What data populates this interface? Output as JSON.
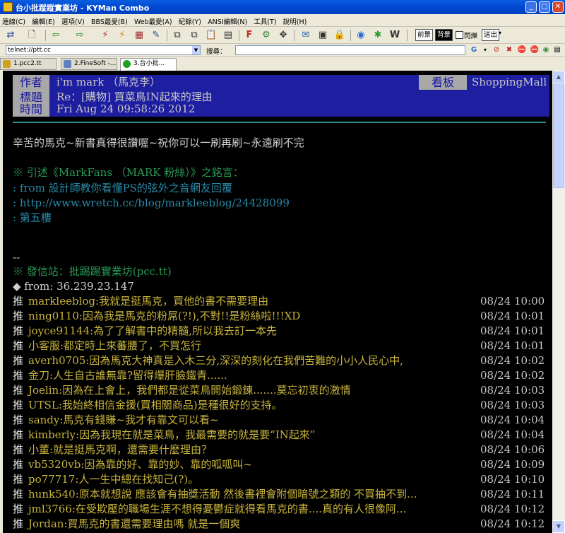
{
  "window": {
    "title": "台小批蹤蹤實業坊 - KYMan Combo"
  },
  "menu": [
    "連線(C)",
    "編輯(E)",
    "選項(V)",
    "BBS最愛(B)",
    "Web最愛(A)",
    "紀錄(Y)",
    "ANSI編輯(N)",
    "工具(T)",
    "說明(H)"
  ],
  "toolbar": {
    "labels": [
      "前景",
      "背景",
      "閃爍",
      "送出"
    ]
  },
  "address": {
    "value": "telnet://ptt.cc",
    "search_label": "搜尋：",
    "search_value": ""
  },
  "tabs": [
    {
      "label": "1.pcc2.tt",
      "icon": "#d0a020"
    },
    {
      "label": "2.FineSoft -...",
      "icon": "#6080c0"
    },
    {
      "label": "3.台小批...",
      "icon": "#20a020"
    }
  ],
  "post": {
    "author_label": "作者",
    "author": "i'm mark （馬克李）",
    "board_label": "看板",
    "board": "ShoppingMall",
    "title_label": "標題",
    "title": "Re：[購物] 買菜鳥IN起來的理由",
    "time_label": "時間",
    "time": "Fri Aug 24  09:58:26 2012",
    "body": "辛苦的馬克~新書真得很讚喔~祝你可以一刷再刷~永遠刷不完",
    "quote_header": "※ 引述《MarkFans （MARK 粉絲）》之銘言：",
    "quote_lines": [
      ": from 設計師教你看懂PS的弦外之音網友回覆",
      ": http://www.wretch.cc/blog/markleeblog/24428099",
      ": 第五樓"
    ],
    "sig_dash": "--",
    "sig_site": "※ 發信站：批踢踢實業坊(pcc.tt)",
    "sig_from": "◆ from: 36.239.23.147"
  },
  "pushes": [
    {
      "tag": "推",
      "text": "markleeblog:我就是挺馬克，買他的書不需要理由",
      "time": "08/24 10:00"
    },
    {
      "tag": "推",
      "text": "ning0110:因為我是馬克的粉屌(?!),不對!!是粉絲啦!!!XD",
      "time": "08/24 10:01"
    },
    {
      "tag": "推",
      "text": "joyce91144:為了了解書中的精髓,所以我去訂一本先",
      "time": "08/24 10:01"
    },
    {
      "tag": "推",
      "text": "小客服:都定時上來蕃腰了，不買怎行",
      "time": "08/24 10:01"
    },
    {
      "tag": "推",
      "text": "averh0705:因為馬克大神真是入木三分,深深的刻化在我們苦難的小小人民心中,",
      "time": "08/24 10:02"
    },
    {
      "tag": "推",
      "text": "金刀:人生自古誰無靠?留得爆肝臉鐵青......",
      "time": "08/24 10:02"
    },
    {
      "tag": "推",
      "text": "Joelin:因為在上會上，我們都是從菜鳥開始鍛鍊.......莫忘初衷的激情",
      "time": "08/24 10:03"
    },
    {
      "tag": "推",
      "text": "UTSL:我始終相信金援(買相關商品)是種很好的支持。",
      "time": "08/24 10:03"
    },
    {
      "tag": "推",
      "text": "sandy:馬克有錢賺~我才有靠文可以看~",
      "time": "08/24 10:04"
    },
    {
      "tag": "推",
      "text": "kimberly:因為我現在就是菜鳥，我最需要的就是要“IN起來”",
      "time": "08/24 10:04"
    },
    {
      "tag": "推",
      "text": "小董:就是挺馬克啊，還需要什麼理由？",
      "time": "08/24 10:06"
    },
    {
      "tag": "推",
      "text": "vb5320vb:因為靠的好、靠的妙、靠的呱呱叫~",
      "time": "08/24 10:09"
    },
    {
      "tag": "推",
      "text": "po77717:人一生中總在找知己(?)。",
      "time": "08/24 10:10"
    },
    {
      "tag": "推",
      "text": "hunk540:原本就想說 應該會有抽獎活動 然後書裡會附個暗號之類的 不買抽不到...",
      "time": "08/24 10:11"
    },
    {
      "tag": "推",
      "text": "jml3766:在受欺壓的職場生涯不想得憂鬱症就得看馬克的書....真的有人很像阿...",
      "time": "08/24 10:12"
    },
    {
      "tag": "推",
      "text": "Jordan:買馬克的書還需要理由嗎 就是一個爽",
      "time": "08/24 10:12"
    }
  ]
}
